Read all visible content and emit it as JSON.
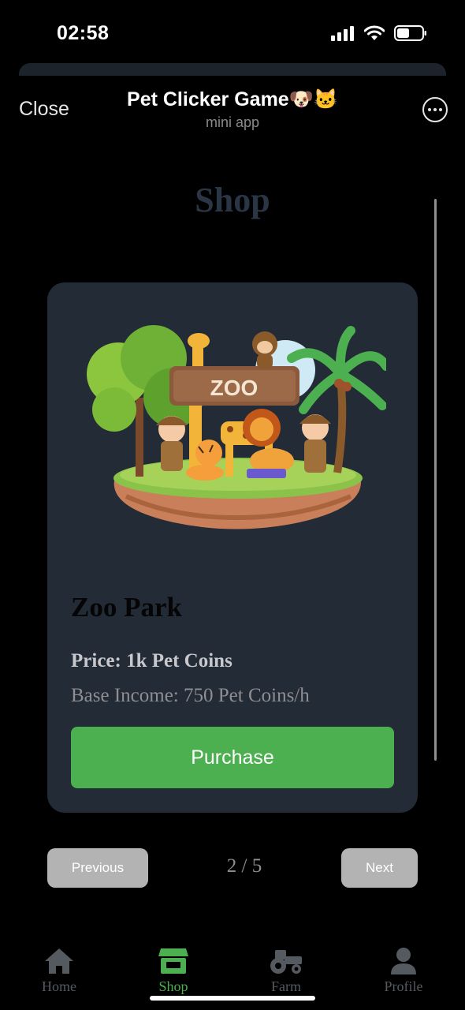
{
  "status_bar": {
    "time": "02:58"
  },
  "header": {
    "close_label": "Close",
    "title": "Pet Clicker Game🐶🐱",
    "subtitle": "mini app"
  },
  "shop": {
    "title": "Shop",
    "item": {
      "name": "Zoo Park",
      "price": "Price: 1k Pet Coins",
      "income": "Base Income: 750 Pet Coins/h",
      "image_sign": "ZOO",
      "purchase_label": "Purchase"
    },
    "pagination": {
      "previous_label": "Previous",
      "indicator": "2 / 5",
      "next_label": "Next"
    }
  },
  "nav": {
    "items": [
      {
        "label": "Home",
        "icon": "home-icon"
      },
      {
        "label": "Shop",
        "icon": "store-icon",
        "active": true
      },
      {
        "label": "Farm",
        "icon": "tractor-icon"
      },
      {
        "label": "Profile",
        "icon": "person-icon"
      }
    ]
  },
  "colors": {
    "background": "#000000",
    "card": "#222b36",
    "accent": "#4caf50",
    "button_gray": "#b3b3b3",
    "nav_inactive": "#555a60"
  }
}
